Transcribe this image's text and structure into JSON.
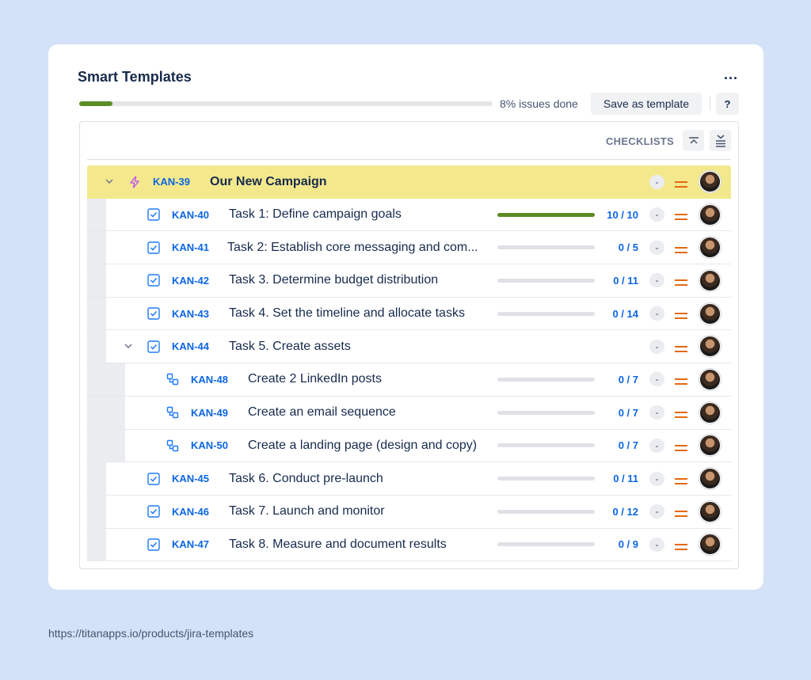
{
  "card": {
    "title": "Smart Templates",
    "more_label": "...",
    "progress": {
      "fraction": 0.08,
      "text": "8% issues done"
    },
    "save_label": "Save as template",
    "help_label": "?",
    "checklists_label": "CHECKLISTS"
  },
  "colors": {
    "background": "#d3e2f7",
    "root_row": "#f3e88c",
    "progress_green": "#5b8c26",
    "key_blue": "#0c66e4",
    "priority_orange": "#e56910",
    "epic_purple": "#c25cf0"
  },
  "rows": [
    {
      "key": "KAN-39",
      "summary": "Our New Campaign",
      "icon": "lightning-icon",
      "level": 0,
      "expanded": true,
      "count": "",
      "progress": null,
      "status": "-",
      "priority": "medium-priority-icon"
    },
    {
      "key": "KAN-40",
      "summary": "Task 1: Define campaign goals",
      "icon": "checkbox-task-icon",
      "level": 1,
      "count": "10 / 10",
      "progress": 1.0,
      "status": "-",
      "priority": "medium-priority-icon"
    },
    {
      "key": "KAN-41",
      "summary": "Task 2: Establish core messaging and com...",
      "icon": "checkbox-task-icon",
      "level": 1,
      "count": "0 / 5",
      "progress": 0,
      "status": "-",
      "priority": "medium-priority-icon"
    },
    {
      "key": "KAN-42",
      "summary": "Task 3. Determine budget distribution",
      "icon": "checkbox-task-icon",
      "level": 1,
      "count": "0 / 11",
      "progress": 0,
      "status": "-",
      "priority": "medium-priority-icon"
    },
    {
      "key": "KAN-43",
      "summary": "Task 4. Set the timeline and allocate tasks",
      "icon": "checkbox-task-icon",
      "level": 1,
      "count": "0 / 14",
      "progress": 0,
      "status": "-",
      "priority": "medium-priority-icon"
    },
    {
      "key": "KAN-44",
      "summary": "Task 5. Create assets",
      "icon": "checkbox-task-icon",
      "level": 1,
      "expanded": true,
      "count": "",
      "progress": null,
      "status": "-",
      "priority": "medium-priority-icon"
    },
    {
      "key": "KAN-48",
      "summary": "Create 2 LinkedIn posts",
      "icon": "subtask-icon",
      "level": 2,
      "count": "0 / 7",
      "progress": 0,
      "status": "-",
      "priority": "medium-priority-icon"
    },
    {
      "key": "KAN-49",
      "summary": "Create an email sequence",
      "icon": "subtask-icon",
      "level": 2,
      "count": "0 / 7",
      "progress": 0,
      "status": "-",
      "priority": "medium-priority-icon"
    },
    {
      "key": "KAN-50",
      "summary": "Create a landing page (design and copy)",
      "icon": "subtask-icon",
      "level": 2,
      "count": "0 / 7",
      "progress": 0,
      "status": "-",
      "priority": "medium-priority-icon"
    },
    {
      "key": "KAN-45",
      "summary": "Task 6. Conduct pre-launch",
      "icon": "checkbox-task-icon",
      "level": 1,
      "count": "0 / 11",
      "progress": 0,
      "status": "-",
      "priority": "medium-priority-icon"
    },
    {
      "key": "KAN-46",
      "summary": "Task 7. Launch and monitor",
      "icon": "checkbox-task-icon",
      "level": 1,
      "count": "0 / 12",
      "progress": 0,
      "status": "-",
      "priority": "medium-priority-icon"
    },
    {
      "key": "KAN-47",
      "summary": "Task 8. Measure and document results",
      "icon": "checkbox-task-icon",
      "level": 1,
      "count": "0 / 9",
      "progress": 0,
      "status": "-",
      "priority": "medium-priority-icon"
    }
  ],
  "footer": {
    "url": "https://titanapps.io/products/jira-templates"
  }
}
